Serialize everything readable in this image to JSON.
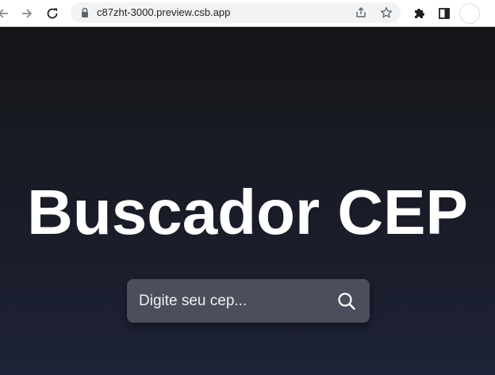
{
  "browser": {
    "url": "c87zht-3000.preview.csb.app",
    "icons": [
      "back-arrow-icon",
      "forward-arrow-icon",
      "reload-icon",
      "lock-icon",
      "share-icon",
      "star-icon",
      "puzzle-extension-icon",
      "side-panel-icon",
      "profile-avatar"
    ]
  },
  "page": {
    "title": "Buscador CEP",
    "search": {
      "placeholder": "Digite seu cep...",
      "value": "",
      "button_icon": "search-icon"
    }
  },
  "colors": {
    "background_top": "#141517",
    "background_bottom": "#1d2236",
    "search_box": "#4b4f5c",
    "title": "#ffffff"
  }
}
